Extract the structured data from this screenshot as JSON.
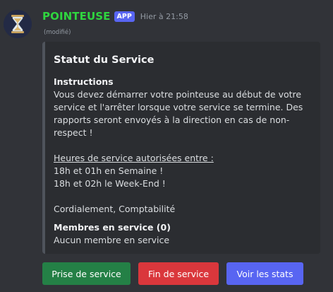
{
  "message": {
    "author": "POINTEUSE",
    "badge": "APP",
    "timestamp": "Hier à 21:58",
    "edited": "(modifié)",
    "avatar_icon": "hourglass-icon"
  },
  "embed": {
    "title": "Statut du Service",
    "instructions_title": "Instructions",
    "instructions_text": "Vous devez démarrer votre pointeuse au début de votre service et l'arrêter lorsque votre service se termine. Des rapports seront envoyés à la direction en cas de non-respect !",
    "hours_title": "Heures de service autorisées entre :",
    "hours_week": "18h et 01h en Semaine !",
    "hours_weekend": "18h et 02h le Week-End !",
    "signature": "Cordialement, Comptabilité",
    "members_title": "Membres en service (0)",
    "members_text": "Aucun membre en service",
    "accent_color": "#4f545c"
  },
  "buttons": {
    "start": "Prise de service",
    "end": "Fin de service",
    "stats": "Voir les stats"
  },
  "colors": {
    "background": "#313338",
    "embed_background": "#2b2d31",
    "username": "#2fd53f",
    "start_button": "#248046",
    "end_button": "#da373c",
    "stats_button": "#5865f2"
  }
}
